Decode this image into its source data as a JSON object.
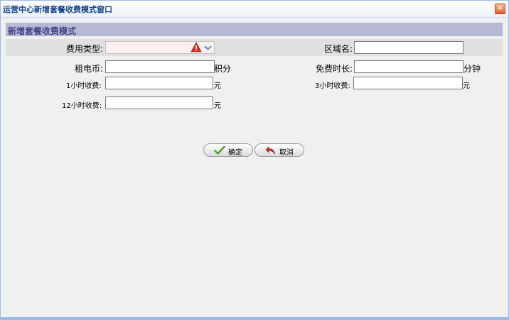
{
  "window": {
    "title": "运营中心新增套餐收费模式窗口",
    "close_glyph": "×"
  },
  "section": {
    "title": "新增套餐收费模式"
  },
  "form": {
    "fee_type": {
      "label": "费用类型:",
      "value": ""
    },
    "region": {
      "label": "区域名:",
      "value": ""
    },
    "rent_currency": {
      "label": "租电币:",
      "value": "",
      "unit": "积分"
    },
    "free_duration": {
      "label": "免费时长:",
      "value": "",
      "unit": "分钟"
    },
    "fee_1h": {
      "label": "1小时收费:",
      "value": "",
      "unit": "元"
    },
    "fee_3h": {
      "label": "3小时收费:",
      "value": "",
      "unit": "元"
    },
    "fee_12h": {
      "label": "12小时收费:",
      "value": "",
      "unit": "元"
    }
  },
  "buttons": {
    "confirm": "确定",
    "cancel": "取消"
  },
  "colors": {
    "accent": "#15428b",
    "header_bg": "#b7b8d3",
    "warning": "#d9302c",
    "confirm_icon": "#4aa02c",
    "cancel_icon": "#c0392b"
  }
}
